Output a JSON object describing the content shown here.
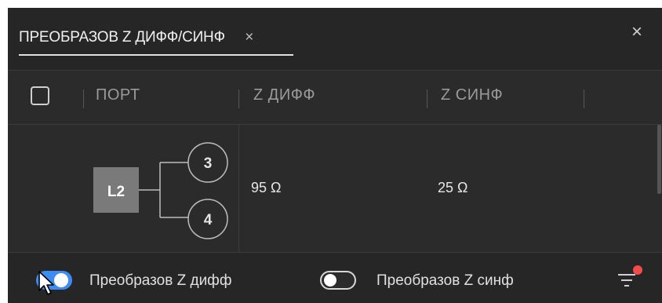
{
  "tab": {
    "label": "ПРЕОБРАЗОВ Z ДИФФ/СИНФ",
    "close": "×"
  },
  "panel": {
    "close": "×"
  },
  "table": {
    "headers": [
      "ПОРТ",
      "Z ДИФФ",
      "Z СИНФ"
    ],
    "rows": [
      {
        "port": "L2",
        "sub_ports": [
          "3",
          "4"
        ],
        "z_diff": "95 Ω",
        "z_cm": "25 Ω"
      }
    ]
  },
  "footer": {
    "diff_toggle": {
      "label": "Преобразов Z дифф",
      "state": "on"
    },
    "cm_toggle": {
      "label": "Преобразов Z синф",
      "state": "off"
    },
    "filter_icon": "filter-icon"
  },
  "colors": {
    "panel_bg": "#2b2b2b",
    "toggle_on": "#3d8cf2",
    "notification_dot": "#f24b4b",
    "port_badge": "#7a7a7a"
  }
}
